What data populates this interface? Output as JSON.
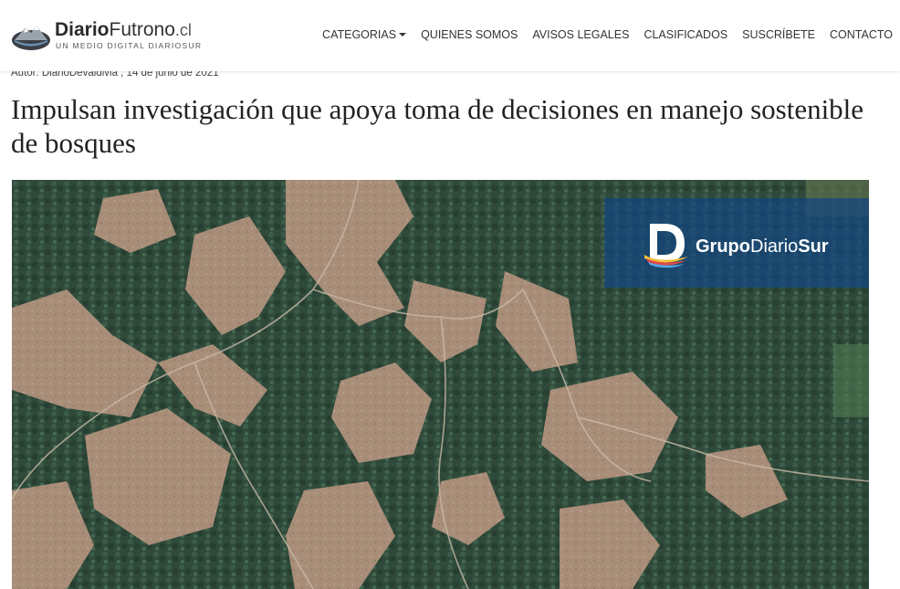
{
  "site": {
    "logo_bold": "Diario",
    "logo_regular": "Futrono",
    "logo_tld": ".cl",
    "logo_tagline": "UN MEDIO DIGITAL DIARIOSUR",
    "logo_icon": "mountain-lake-icon"
  },
  "nav": {
    "items": [
      {
        "label": "CATEGORIAS",
        "dropdown": true
      },
      {
        "label": "QUIENES SOMOS"
      },
      {
        "label": "AVISOS LEGALES"
      },
      {
        "label": "CLASIFICADOS"
      },
      {
        "label": "SUSCRÍBETE"
      },
      {
        "label": "CONTACTO"
      }
    ]
  },
  "article": {
    "byline": "Autor: DiarioDevaldivia , 14 de junio de 2021",
    "headline": "Impulsan investigación que apoya toma de decisiones en manejo sostenible de bosques"
  },
  "image": {
    "watermark_part1": "Grupo",
    "watermark_part2": "Diario",
    "watermark_part3": "Sur",
    "watermark_icon": "grupo-diariosur-d-icon"
  },
  "colors": {
    "forest": "#2f4a3a",
    "clearcut": "#a88d78",
    "watermark_bg": "#1c4f8a"
  }
}
